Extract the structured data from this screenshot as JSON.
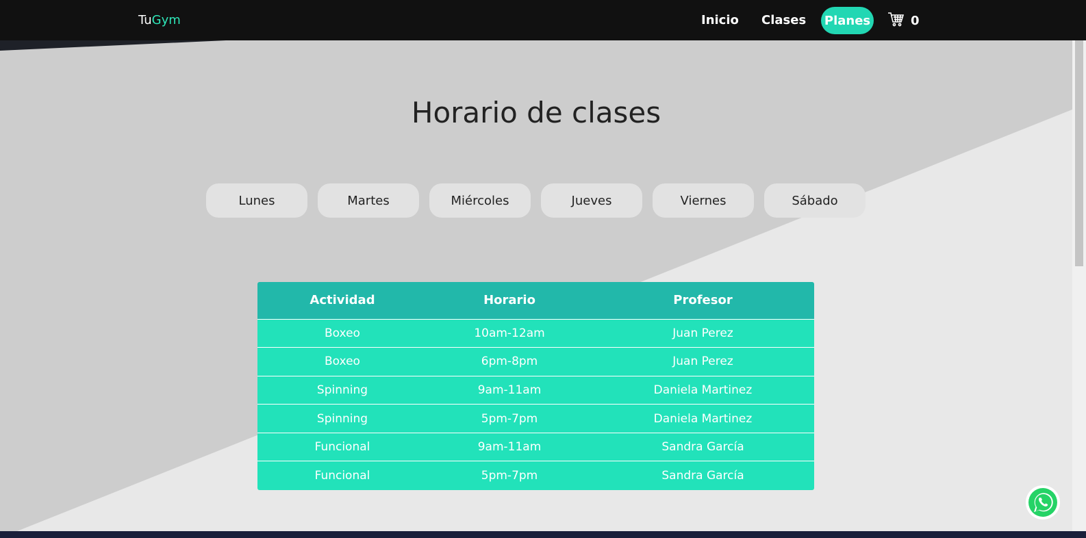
{
  "nav": {
    "brand_prefix": "Tu",
    "brand_suffix": "Gym",
    "links": [
      "Inicio",
      "Clases",
      "Planes"
    ],
    "cart_count": "0"
  },
  "main": {
    "title": "Horario de clases",
    "days": [
      "Lunes",
      "Martes",
      "Miércoles",
      "Jueves",
      "Viernes",
      "Sábado"
    ]
  },
  "table": {
    "headers": [
      "Actividad",
      "Horario",
      "Profesor"
    ],
    "rows": [
      [
        "Boxeo",
        "10am-12am",
        "Juan Perez"
      ],
      [
        "Boxeo",
        "6pm-8pm",
        "Juan Perez"
      ],
      [
        "Spinning",
        "9am-11am",
        "Daniela Martinez"
      ],
      [
        "Spinning",
        "5pm-7pm",
        "Daniela Martinez"
      ],
      [
        "Funcional",
        "9am-11am",
        "Sandra García"
      ],
      [
        "Funcional",
        "5pm-7pm",
        "Sandra García"
      ]
    ]
  },
  "icons": {
    "cart": "cart-icon",
    "whatsapp": "whatsapp-icon"
  },
  "colors": {
    "accent": "#22d7b3",
    "table_header": "#22b8aa",
    "table_row": "#22e2ba",
    "navbar": "#111111",
    "whatsapp": "#25d366"
  }
}
